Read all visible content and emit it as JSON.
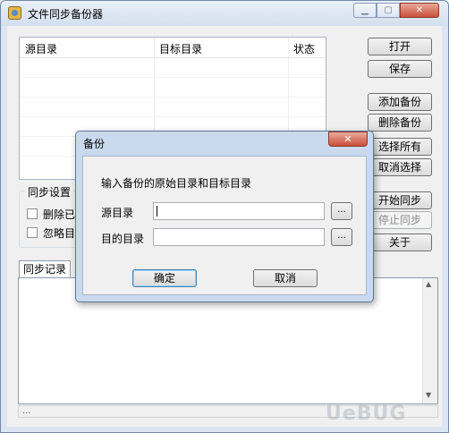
{
  "window": {
    "title": "文件同步备份器",
    "controls": {
      "minimize": "▁",
      "maximize": "▢",
      "close": "✕"
    }
  },
  "list": {
    "columns": [
      "源目录",
      "目标目录",
      "状态"
    ]
  },
  "buttons": {
    "open": "打开",
    "save": "保存",
    "add_backup": "添加备份",
    "delete_backup": "删除备份",
    "select_all": "选择所有",
    "deselect": "取消选择",
    "start_sync": "开始同步",
    "stop_sync": "停止同步",
    "about": "关于"
  },
  "sync_settings": {
    "title": "同步设置",
    "option1": "删除已",
    "option2": "忽略目"
  },
  "log": {
    "tab": "同步记录"
  },
  "status": "...",
  "watermark": "UeBUG",
  "dialog": {
    "title": "备份",
    "close": "✕",
    "prompt": "输入备份的原始目录和目标目录",
    "source_label": "源目录",
    "source_value": "",
    "target_label": "目的目录",
    "target_value": "",
    "browse": "...",
    "ok": "确定",
    "cancel": "取消"
  },
  "colors": {
    "frame": "#dce6f2",
    "close": "#c9503a",
    "dialog_frame": "#c9daee"
  }
}
